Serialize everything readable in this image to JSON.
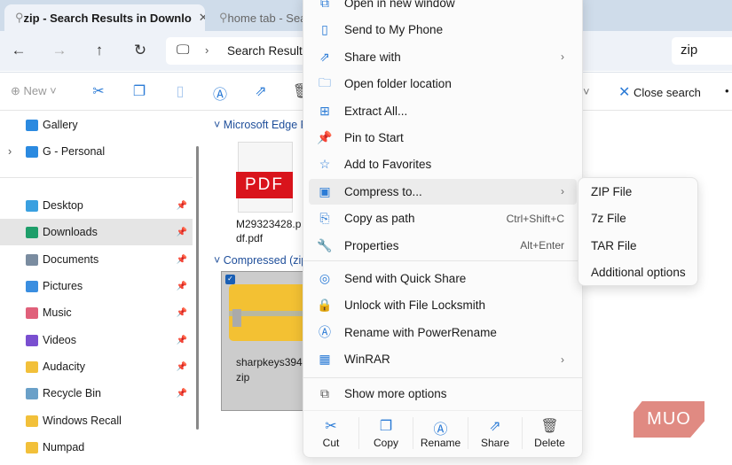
{
  "tabs": [
    {
      "label": "zip - Search Results in Downlo"
    },
    {
      "label": "home tab - Sea"
    }
  ],
  "address": {
    "crumb": "Search Results",
    "search_value": "zip"
  },
  "toolbar": {
    "new_label": "New",
    "close_search": "Close search"
  },
  "sidebar": {
    "items": [
      {
        "label": "Gallery",
        "color": "#2b8ae0"
      },
      {
        "label": "G - Personal",
        "color": "#2b8ae0"
      },
      {
        "label": "Desktop",
        "color": "#3aa0e0",
        "pinned": true
      },
      {
        "label": "Downloads",
        "color": "#1e9e6a",
        "pinned": true,
        "selected": true
      },
      {
        "label": "Documents",
        "color": "#7a8ca0",
        "pinned": true
      },
      {
        "label": "Pictures",
        "color": "#3a8ee0",
        "pinned": true
      },
      {
        "label": "Music",
        "color": "#e0607a",
        "pinned": true
      },
      {
        "label": "Videos",
        "color": "#7a4fd0",
        "pinned": true
      },
      {
        "label": "Audacity",
        "color": "#f2c03a",
        "pinned": true
      },
      {
        "label": "Recycle Bin",
        "color": "#6aa0c8",
        "pinned": true
      },
      {
        "label": "Windows Recall",
        "color": "#f2c03a"
      },
      {
        "label": "Numpad",
        "color": "#f2c03a"
      }
    ]
  },
  "content": {
    "group1": "Microsoft Edge P",
    "file1": "M29323428.pdf.pdf",
    "pdf_label": "PDF",
    "group2": "Compressed (zip",
    "file2": "sharpkeys394.zip"
  },
  "menu": {
    "items": [
      {
        "label": "Open in new window",
        "icon": "open-window"
      },
      {
        "label": "Send to My Phone",
        "icon": "phone"
      },
      {
        "label": "Share with",
        "icon": "share",
        "submenu": true
      },
      {
        "label": "Open folder location",
        "icon": "folder"
      },
      {
        "label": "Extract All...",
        "icon": "extract"
      },
      {
        "label": "Pin to Start",
        "icon": "pin"
      },
      {
        "label": "Add to Favorites",
        "icon": "star"
      },
      {
        "label": "Compress to...",
        "icon": "compress",
        "submenu": true
      },
      {
        "label": "Copy as path",
        "icon": "copy-path",
        "shortcut": "Ctrl+Shift+C"
      },
      {
        "label": "Properties",
        "icon": "wrench",
        "shortcut": "Alt+Enter"
      }
    ],
    "items2": [
      {
        "label": "Send with Quick Share",
        "icon": "quick-share"
      },
      {
        "label": "Unlock with File Locksmith",
        "icon": "lock"
      },
      {
        "label": "Rename with PowerRename",
        "icon": "rename"
      },
      {
        "label": "WinRAR",
        "icon": "winrar",
        "submenu": true
      }
    ],
    "more": "Show more options",
    "bottom": [
      {
        "label": "Cut",
        "icon": "scissors"
      },
      {
        "label": "Copy",
        "icon": "copy"
      },
      {
        "label": "Rename",
        "icon": "rename"
      },
      {
        "label": "Share",
        "icon": "share"
      },
      {
        "label": "Delete",
        "icon": "trash"
      }
    ]
  },
  "submenu": {
    "items": [
      "ZIP File",
      "7z File",
      "TAR File",
      "Additional options"
    ]
  },
  "watermark": "MUO"
}
